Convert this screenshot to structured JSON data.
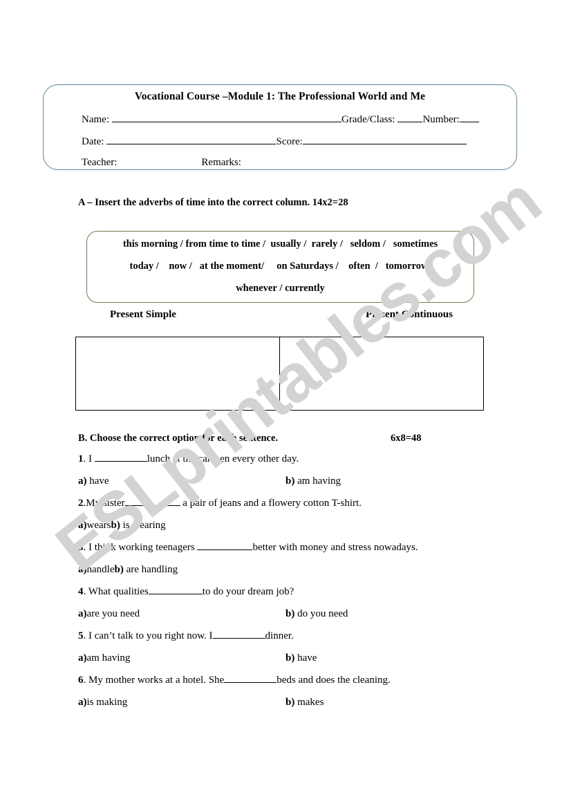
{
  "watermark": {
    "text": "ESLprintables.com",
    "color": "#d3d3d3"
  },
  "header": {
    "title": "Vocational Course –Module 1: The Professional World and Me",
    "name_label": "Name:",
    "grade_label": "Grade/Class:",
    "number_label": "Number:",
    "date_label": "Date:",
    "score_label": "Score:",
    "teacher_label": "Teacher:",
    "remarks_label": "Remarks:",
    "border_color": "#5f87a0"
  },
  "section_a": {
    "heading": "A – Insert the adverbs of time into the correct column. 14x2=28",
    "word_box": {
      "border_color": "#6b7f4a",
      "lines": [
        "this morning / from time to time /  usually /  rarely /   seldom /   sometimes",
        "today /    now /   at the moment/     on Saturdays /    often  /   tomorrow/",
        "whenever / currently"
      ]
    },
    "columns": {
      "left_header": "Present Simple",
      "right_header": "Present Continuous"
    }
  },
  "section_b": {
    "heading": "B. Choose the correct option for each sentence.",
    "points": "6x8=48",
    "questions": [
      {
        "number": "1",
        "pre": ". I ",
        "post": "lunch at the canteen every other day.",
        "option_a": "a) have",
        "option_b": "b) am having",
        "layout": "spaced"
      },
      {
        "number": "2",
        "pre": ".My sister",
        "post": " a pair of jeans and a flowery cotton T-shirt.",
        "option_a": "a)wears",
        "option_b": "b) is wearing",
        "layout": "inline"
      },
      {
        "number": "3",
        "pre": ". I think working teenagers ",
        "post": "better with money and stress nowadays.",
        "option_a": "a)handle",
        "option_b": "b) are handling",
        "layout": "inline"
      },
      {
        "number": "4",
        "pre": ". What qualities",
        "post": "to do your dream job?",
        "option_a": "a)are you need",
        "option_b": "b) do you need",
        "layout": "spaced"
      },
      {
        "number": "5",
        "pre": ". I can’t talk to you right now. I",
        "post": "dinner.",
        "option_a": "a)am having",
        "option_b": "b) have",
        "layout": "spaced"
      },
      {
        "number": "6",
        "pre": ". My mother works at a hotel. She",
        "post": "beds and does the cleaning.",
        "option_a": "a)is making",
        "option_b": "b) makes",
        "layout": "spaced"
      }
    ]
  }
}
